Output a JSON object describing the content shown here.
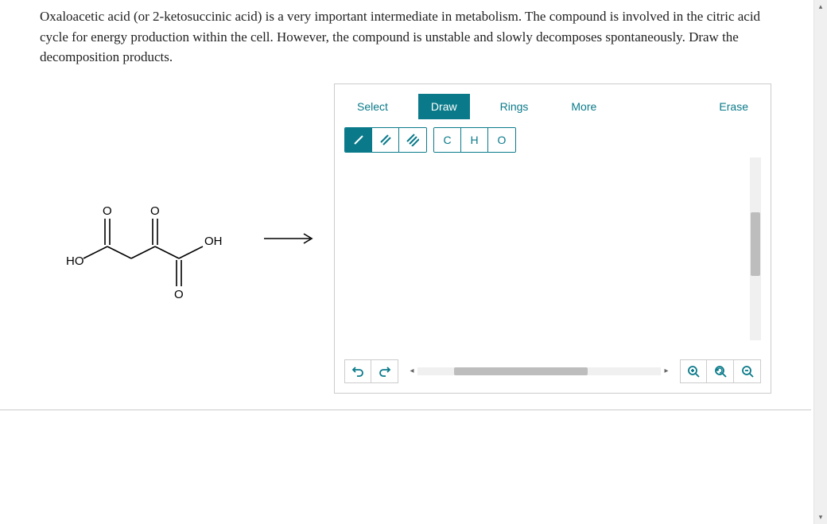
{
  "prompt": "Oxaloacetic acid (or 2-ketosuccinic acid) is a very important intermediate in metabolism. The compound is involved in the citric acid cycle for energy production within the cell. However, the compound is unstable and slowly decomposes spontaneously. Draw the decomposition products.",
  "structure_labels": {
    "ho": "HO",
    "oh": "OH",
    "o1": "O",
    "o2": "O",
    "o3": "O"
  },
  "toolbar": {
    "select": "Select",
    "draw": "Draw",
    "rings": "Rings",
    "more": "More",
    "erase": "Erase"
  },
  "atoms": {
    "c": "C",
    "h": "H",
    "o": "O"
  },
  "bonds": {
    "single": "/",
    "double": "//",
    "triple": "///"
  }
}
